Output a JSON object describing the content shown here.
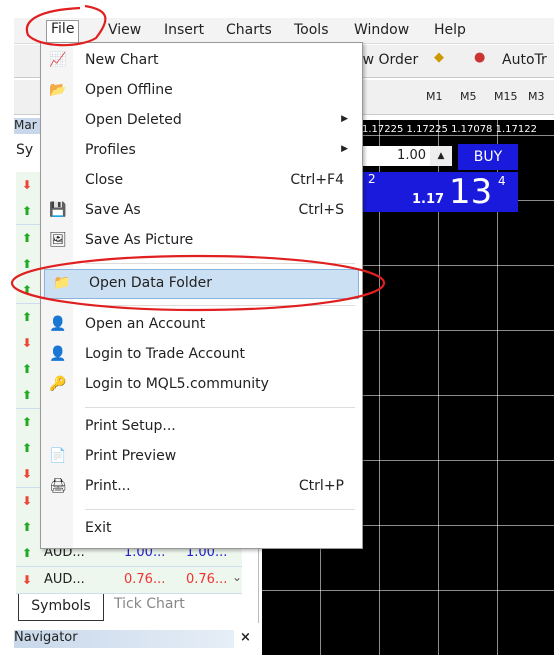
{
  "menubar": [
    "File",
    "View",
    "Insert",
    "Charts",
    "Tools",
    "Window",
    "Help"
  ],
  "toolbar": {
    "new_order": "ew Order",
    "autotrading": "AutoTr",
    "timeframes": [
      "M1",
      "M5",
      "M15",
      "M3"
    ]
  },
  "chart": {
    "prices": "1.17225 1.17225 1.17078 1.17122",
    "lot": "1.00",
    "buy": "BUY",
    "bid_small": "2",
    "ask_big": "13",
    "ask_prefix": "1.17",
    "ask_sup": "4"
  },
  "market_watch": {
    "title": "Mar",
    "col": "Sy",
    "rows": [
      {
        "dir": "down"
      },
      {
        "dir": "up"
      },
      {
        "dir": "up"
      },
      {
        "dir": "up"
      },
      {
        "dir": "up"
      },
      {
        "dir": "up"
      },
      {
        "dir": "down"
      },
      {
        "dir": "up"
      },
      {
        "dir": "up"
      },
      {
        "dir": "up"
      },
      {
        "dir": "up"
      },
      {
        "dir": "down"
      },
      {
        "dir": "down"
      },
      {
        "dir": "up"
      },
      {
        "dir": "up",
        "sym": "AUD...",
        "bid": "1.00...",
        "ask": "1.00..."
      },
      {
        "dir": "down",
        "sym": "AUD...",
        "bid": "0.76...",
        "ask": "0.76..."
      }
    ],
    "tabs": [
      "Symbols",
      "Tick Chart"
    ]
  },
  "navigator": {
    "title": "Navigator",
    "close": "×"
  },
  "file_menu": [
    {
      "label": "New Chart",
      "icon": "new-chart-icon",
      "glyph": "📈"
    },
    {
      "label": "Open Offline",
      "icon": "folder-open-icon",
      "glyph": "📂"
    },
    {
      "label": "Open Deleted",
      "submenu": true
    },
    {
      "label": "Profiles",
      "submenu": true
    },
    {
      "label": "Close",
      "shortcut": "Ctrl+F4"
    },
    {
      "label": "Save As",
      "shortcut": "Ctrl+S",
      "icon": "save-icon",
      "glyph": "💾"
    },
    {
      "label": "Save As Picture",
      "icon": "picture-icon",
      "glyph": "🖼"
    },
    {
      "sep": true
    },
    {
      "label": "Open Data Folder",
      "icon": "folder-icon",
      "glyph": "📁",
      "highlighted": true
    },
    {
      "sep": true
    },
    {
      "label": "Open an Account",
      "icon": "add-user-icon",
      "glyph": "👤"
    },
    {
      "label": "Login to Trade Account",
      "icon": "user-icon",
      "glyph": "👤"
    },
    {
      "label": "Login to MQL5.community",
      "icon": "mql5-icon",
      "glyph": "🔑"
    },
    {
      "sep": true
    },
    {
      "label": "Print Setup..."
    },
    {
      "label": "Print Preview",
      "icon": "print-preview-icon",
      "glyph": "📄"
    },
    {
      "label": "Print...",
      "shortcut": "Ctrl+P",
      "icon": "printer-icon",
      "glyph": "🖨"
    },
    {
      "sep": true
    },
    {
      "label": "Exit"
    }
  ],
  "colors": {
    "annotation": "#e02020",
    "highlight": "#cce0f4",
    "buy_panel": "#1a1adc"
  }
}
